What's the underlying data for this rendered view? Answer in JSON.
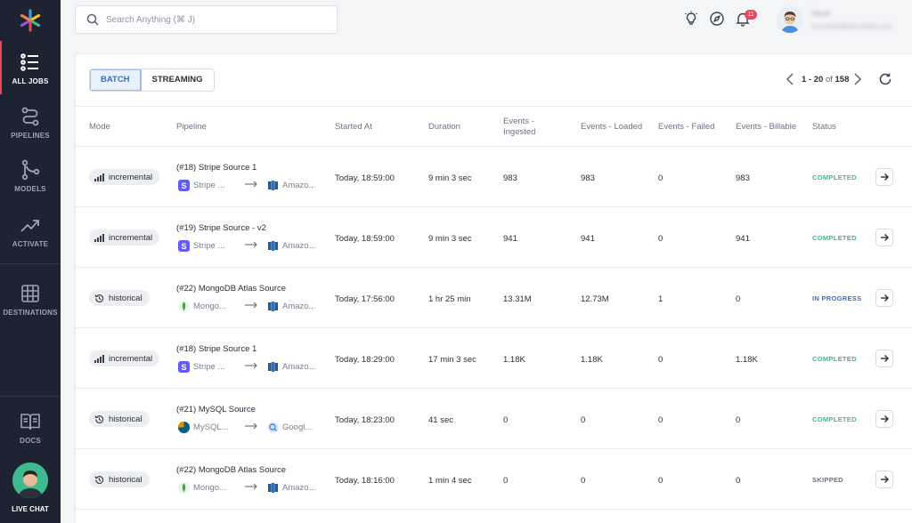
{
  "sidebar": {
    "items": [
      {
        "label": "ALL JOBS"
      },
      {
        "label": "PIPELINES"
      },
      {
        "label": "MODELS"
      },
      {
        "label": "ACTIVATE"
      },
      {
        "label": "DESTINATIONS"
      },
      {
        "label": "DOCS"
      },
      {
        "label": "LIVE CHAT"
      }
    ]
  },
  "topbar": {
    "search_placeholder": "Search Anything  (⌘ J)",
    "notification_count": "11",
    "user_name": "Hevo",
    "user_email": "hevodata@hevodata.com"
  },
  "toolbar": {
    "tabs": [
      {
        "label": "BATCH",
        "selected": true
      },
      {
        "label": "STREAMING",
        "selected": false
      }
    ],
    "pagination": {
      "range": "1 - 20",
      "of": "of",
      "total": "158"
    }
  },
  "table": {
    "headers": [
      "Mode",
      "Pipeline",
      "Started At",
      "Duration",
      "Events - Ingested",
      "Events - Loaded",
      "Events - Failed",
      "Events - Billable",
      "Status"
    ],
    "rows": [
      {
        "mode": "incremental",
        "pipeline": "(#18) Stripe Source 1",
        "source": "Stripe ...",
        "source_icon": "stripe-icon",
        "dest": "Amazo...",
        "dest_icon": "amazon-redshift-icon",
        "started": "Today, 18:59:00",
        "duration": "9 min 3 sec",
        "ingested": "983",
        "loaded": "983",
        "failed": "0",
        "billable": "983",
        "status": "COMPLETED"
      },
      {
        "mode": "incremental",
        "pipeline": "(#19) Stripe Source - v2",
        "source": "Stripe ...",
        "source_icon": "stripe-icon",
        "dest": "Amazo...",
        "dest_icon": "amazon-redshift-icon",
        "started": "Today, 18:59:00",
        "duration": "9 min 3 sec",
        "ingested": "941",
        "loaded": "941",
        "failed": "0",
        "billable": "941",
        "status": "COMPLETED"
      },
      {
        "mode": "historical",
        "pipeline": "(#22) MongoDB Atlas Source",
        "source": "Mongo...",
        "source_icon": "mongodb-icon",
        "dest": "Amazo...",
        "dest_icon": "amazon-redshift-icon",
        "started": "Today, 17:56:00",
        "duration": "1 hr 25 min",
        "ingested": "13.31M",
        "loaded": "12.73M",
        "failed": "1",
        "billable": "0",
        "status": "IN PROGRESS"
      },
      {
        "mode": "incremental",
        "pipeline": "(#18) Stripe Source 1",
        "source": "Stripe ...",
        "source_icon": "stripe-icon",
        "dest": "Amazo...",
        "dest_icon": "amazon-redshift-icon",
        "started": "Today, 18:29:00",
        "duration": "17 min 3 sec",
        "ingested": "1.18K",
        "loaded": "1.18K",
        "failed": "0",
        "billable": "1.18K",
        "status": "COMPLETED"
      },
      {
        "mode": "historical",
        "pipeline": "(#21) MySQL Source",
        "source": "MySQL...",
        "source_icon": "mysql-icon",
        "dest": "Googl...",
        "dest_icon": "google-bigquery-icon",
        "started": "Today, 18:23:00",
        "duration": "41 sec",
        "ingested": "0",
        "loaded": "0",
        "failed": "0",
        "billable": "0",
        "status": "COMPLETED"
      },
      {
        "mode": "historical",
        "pipeline": "(#22) MongoDB Atlas Source",
        "source": "Mongo...",
        "source_icon": "mongodb-icon",
        "dest": "Amazo...",
        "dest_icon": "amazon-redshift-icon",
        "started": "Today, 18:16:00",
        "duration": "1 min 4 sec",
        "ingested": "0",
        "loaded": "0",
        "failed": "0",
        "billable": "0",
        "status": "SKIPPED"
      }
    ]
  },
  "colors": {
    "completed": "#3dba8f",
    "in_progress": "#3a6fc1",
    "skipped": "#6b7280",
    "sidebar_bg": "#1d2331",
    "accent": "#e5485a"
  }
}
